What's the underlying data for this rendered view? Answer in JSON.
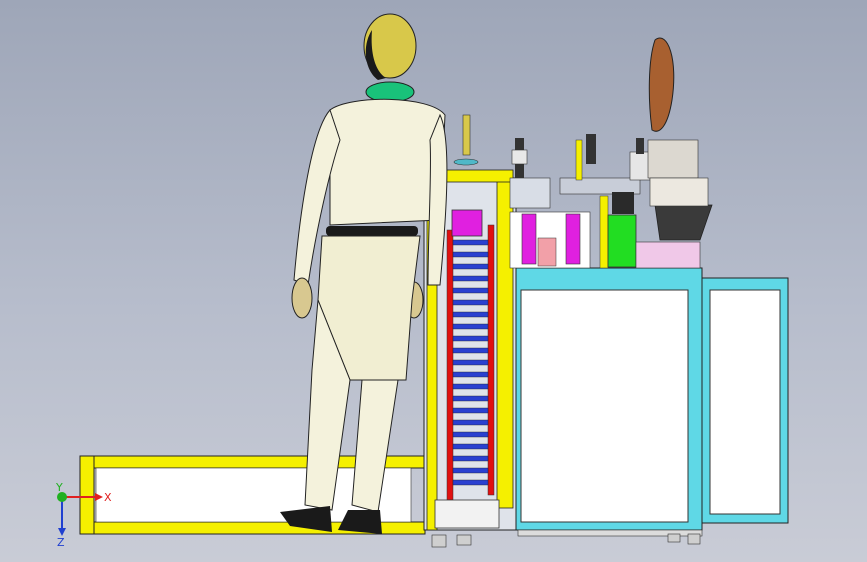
{
  "viewport": {
    "background_top": "#9ea6b8",
    "background_bottom": "#c9ccd6"
  },
  "colors": {
    "frame_yellow": "#f5f000",
    "cabinet_cyan": "#5fd8e6",
    "cabinet_panel": "#ffffff",
    "mannequin_suit": "#f4f2dc",
    "mannequin_collar": "#19c27a",
    "helmet_gold": "#d8c84a",
    "magenta_block": "#e020e0",
    "green_block": "#22dd22",
    "conveyor_red": "#e01010",
    "conveyor_blue": "#2a40d0",
    "axis_x": "#e02020",
    "axis_y": "#20b020",
    "axis_z": "#2040d0"
  },
  "triad": {
    "x_label": "X",
    "y_label": "Y",
    "z_label": "Z"
  },
  "icons": {
    "triad": "coordinate-triad-icon"
  }
}
